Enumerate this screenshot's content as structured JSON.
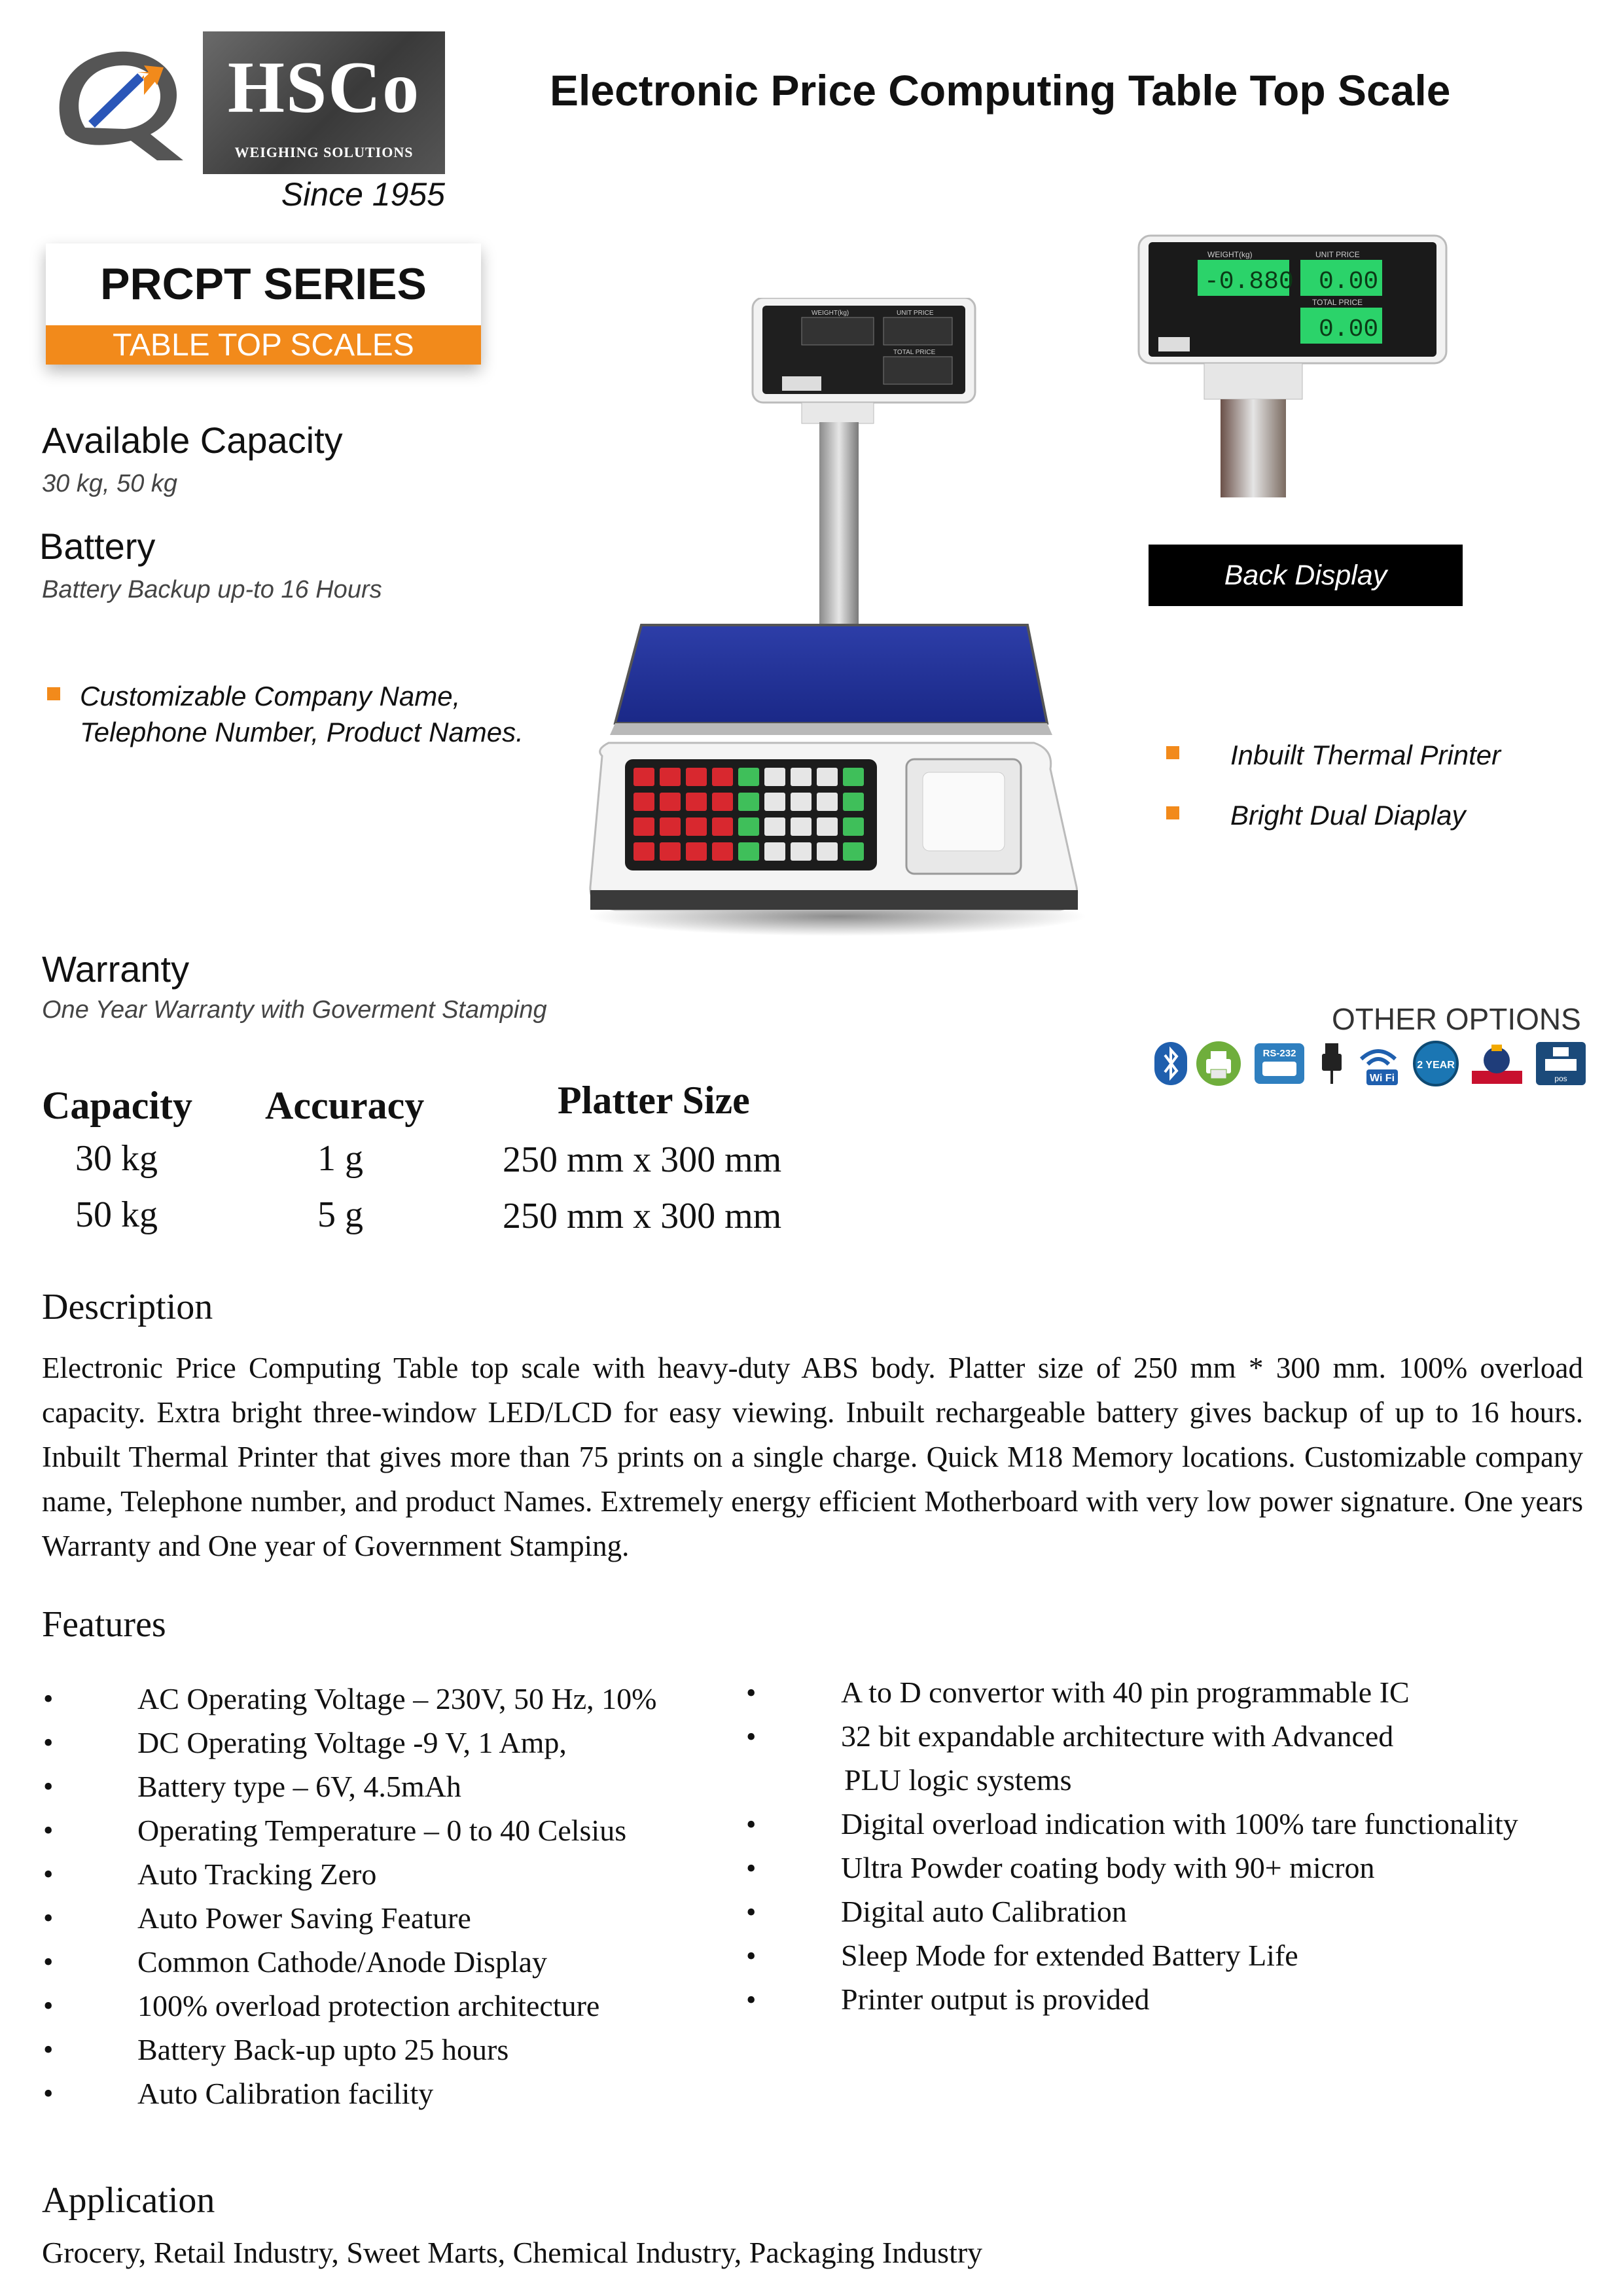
{
  "brand": {
    "name": "HSCo",
    "tagline": "WEIGHING SOLUTIONS",
    "since": "Since 1955"
  },
  "title": "Electronic Price Computing Table Top Scale",
  "series": {
    "name": "PRCPT SERIES",
    "subtitle": "TABLE TOP SCALES",
    "accent_color": "#f28a1b"
  },
  "available_capacity": {
    "heading": "Available Capacity",
    "value": "30 kg, 50 kg"
  },
  "battery": {
    "heading": "Battery",
    "value": "Battery Backup up-to 16 Hours"
  },
  "customization_bullet": {
    "line1": "Customizable Company Name,",
    "line2": "Telephone Number, Product Names."
  },
  "back_display_label": "Back Display",
  "highlights": [
    "Inbuilt Thermal Printer",
    "Bright Dual Diaplay"
  ],
  "warranty": {
    "heading": "Warranty",
    "value": "One Year Warranty with Goverment Stamping"
  },
  "other_options": {
    "label": "OTHER OPTIONS",
    "icons": [
      "bluetooth-icon",
      "printer-icon",
      "rs232-icon",
      "usb-icon",
      "wifi-icon",
      "two-year-warranty-icon",
      "government-stamp-icon",
      "pos-icon"
    ],
    "icon_texts": {
      "rs232": "RS-232",
      "wifi": "Wi Fi",
      "warranty": "2 YEAR",
      "pos": "pos"
    }
  },
  "scale_images": {
    "front_display": {
      "weighing": "WEIGHT(kg)",
      "unit_price": "UNIT PRICE",
      "total_price": "TOTAL PRICE"
    },
    "back_display": {
      "weighing": "WEIGHT(kg)",
      "unit_price": "UNIT PRICE",
      "total_price": "TOTAL PRICE",
      "weight_reading": "-0.880",
      "unit_reading": "0.00",
      "total_reading": "0.00"
    }
  },
  "specs": {
    "headers": [
      "Capacity",
      "Accuracy",
      "Platter Size"
    ],
    "rows": [
      [
        "30 kg",
        "1 g",
        "250 mm x 300 mm"
      ],
      [
        "50 kg",
        "5 g",
        "250 mm x 300 mm"
      ]
    ]
  },
  "description": {
    "heading": "Description",
    "text": "Electronic Price Computing Table top scale with heavy-duty ABS body. Platter size of 250 mm * 300 mm. 100% overload capacity. Extra bright three-window LED/LCD for easy viewing. Inbuilt rechargeable battery gives backup of up to 16 hours. Inbuilt Thermal Printer that gives more than 75 prints on a single charge. Quick M18 Memory locations. Customizable company name, Telephone number, and product Names. Extremely energy efficient Motherboard with very low power signature. One years Warranty and One year of Government Stamping."
  },
  "features": {
    "heading": "Features",
    "bullet": "•",
    "left": [
      "AC Operating Voltage – 230V, 50 Hz, 10%",
      "DC Operating Voltage -9 V, 1 Amp,",
      "Battery type – 6V, 4.5mAh",
      "Operating Temperature – 0 to 40 Celsius",
      "Auto Tracking Zero",
      "Auto Power Saving Feature",
      "Common Cathode/Anode Display",
      "100% overload protection architecture",
      "Battery Back-up upto 25 hours",
      "Auto Calibration facility"
    ],
    "right": [
      "A to D convertor with 40 pin programmable IC",
      "32 bit expandable architecture with Advanced",
      "Digital overload indication with 100% tare functionality",
      "Ultra Powder coating body with 90+ micron",
      "Digital auto Calibration",
      "Sleep Mode for extended Battery Life",
      "Printer output is provided"
    ],
    "right_continuation": "PLU logic systems"
  },
  "application": {
    "heading": "Application",
    "text": "Grocery, Retail Industry, Sweet Marts, Chemical Industry, Packaging Industry"
  }
}
